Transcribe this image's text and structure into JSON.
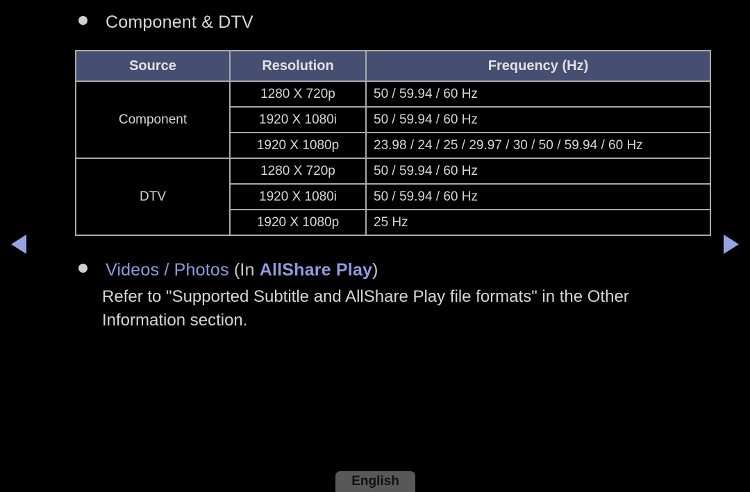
{
  "sections": {
    "component_dtv": {
      "bullet_icon": "bullet-dot-icon",
      "title": "Component & DTV"
    },
    "videos_photos": {
      "bullet_icon": "bullet-dot-icon",
      "title_accent": "Videos / Photos",
      "paren_open": " (In ",
      "title_strong": "AllShare Play",
      "paren_close": ")"
    }
  },
  "table": {
    "headers": [
      "Source",
      "Resolution",
      "Frequency (Hz)"
    ],
    "groups": [
      {
        "source": "Component",
        "rows": [
          {
            "resolution": "1280 X 720p",
            "frequency": "50 / 59.94 / 60 Hz"
          },
          {
            "resolution": "1920 X 1080i",
            "frequency": "50 / 59.94 / 60 Hz"
          },
          {
            "resolution": "1920 X 1080p",
            "frequency": "23.98 / 24 / 25 / 29.97 / 30 / 50 / 59.94 / 60 Hz"
          }
        ]
      },
      {
        "source": "DTV",
        "rows": [
          {
            "resolution": "1280 X 720p",
            "frequency": "50 / 59.94 / 60 Hz"
          },
          {
            "resolution": "1920 X 1080i",
            "frequency": "50 / 59.94 / 60 Hz"
          },
          {
            "resolution": "1920 X 1080p",
            "frequency": "25 Hz"
          }
        ]
      }
    ]
  },
  "body_paragraph": "Refer to \"Supported Subtitle and AllShare Play file formats\" in the Other Information section.",
  "navigation": {
    "prev_icon": "triangle-left-icon",
    "next_icon": "triangle-right-icon"
  },
  "language_button": {
    "label": "English"
  },
  "colors": {
    "background": "#000000",
    "table_header_bg": "#464f72",
    "table_border": "#a9a9a9",
    "text": "#d6d6d6",
    "accent_blue": "#8f9be0",
    "arrow_blue": "#95a3e2",
    "language_button_bg": "#585858"
  }
}
